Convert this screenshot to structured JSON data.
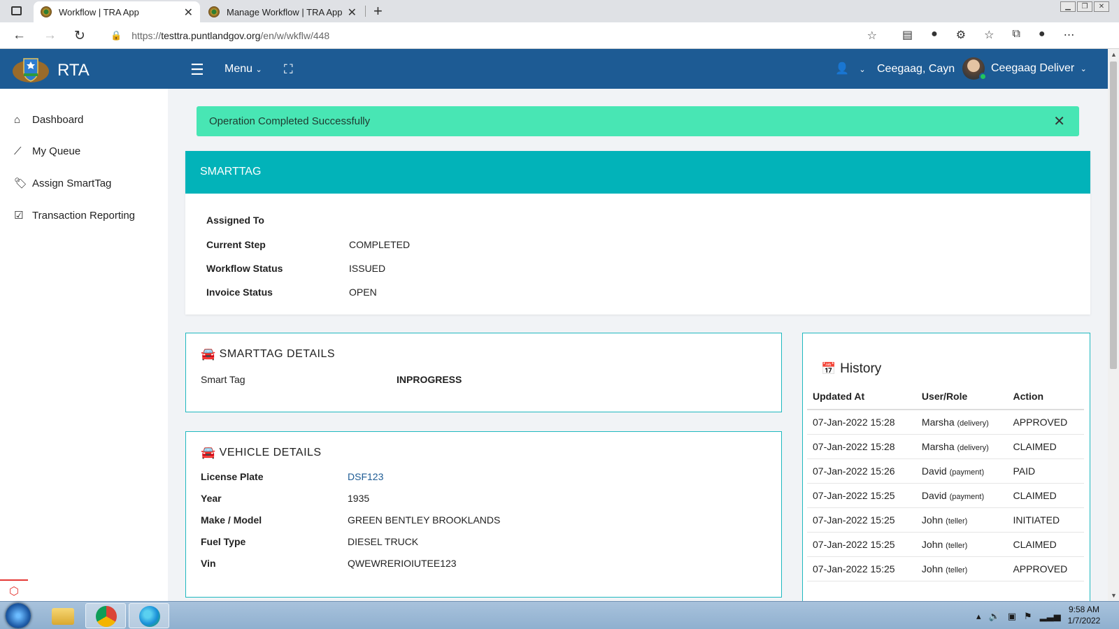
{
  "browser": {
    "tabs": [
      {
        "title": "Workflow | TRA App",
        "active": true
      },
      {
        "title": "Manage Workflow | TRA App",
        "active": false
      }
    ],
    "url_prefix": "https://",
    "url_host": "testtra.puntlandgov.org",
    "url_path": "/en/w/wkflw/448"
  },
  "header": {
    "brand": "RTA",
    "menu_label": "Menu",
    "location": "Ceegaag, Cayn",
    "user_name": "Ceegaag Deliver"
  },
  "sidebar": {
    "items": [
      {
        "label": "Dashboard",
        "icon": "home-icon"
      },
      {
        "label": "My Queue",
        "icon": "chart-line-icon"
      },
      {
        "label": "Assign SmartTag",
        "icon": "tags-icon"
      },
      {
        "label": "Transaction Reporting",
        "icon": "check-square-icon"
      }
    ]
  },
  "alert": {
    "message": "Operation Completed Successfully"
  },
  "smarttag": {
    "title": "SMARTTAG",
    "fields": [
      {
        "label": "Assigned To",
        "value": ""
      },
      {
        "label": "Current Step",
        "value": "COMPLETED"
      },
      {
        "label": "Workflow Status",
        "value": "ISSUED"
      },
      {
        "label": "Invoice Status",
        "value": "OPEN"
      }
    ]
  },
  "smarttag_details": {
    "title": "SMARTTAG DETAILS",
    "label": "Smart Tag",
    "value": "INPROGRESS"
  },
  "vehicle_details": {
    "title": "VEHICLE DETAILS",
    "fields": [
      {
        "label": "License Plate",
        "value": "DSF123"
      },
      {
        "label": "Year",
        "value": "1935"
      },
      {
        "label": "Make / Model",
        "value": "GREEN BENTLEY BROOKLANDS"
      },
      {
        "label": "Fuel Type",
        "value": "DIESEL TRUCK"
      },
      {
        "label": "Vin",
        "value": "QWEWRERIOIUTEE123"
      }
    ]
  },
  "history": {
    "title": "History",
    "columns": [
      "Updated At",
      "User/Role",
      "Action"
    ],
    "rows": [
      {
        "updated_at": "07-Jan-2022 15:28",
        "user": "Marsha",
        "role": "(delivery)",
        "action": "APPROVED"
      },
      {
        "updated_at": "07-Jan-2022 15:28",
        "user": "Marsha",
        "role": "(delivery)",
        "action": "CLAIMED"
      },
      {
        "updated_at": "07-Jan-2022 15:26",
        "user": "David",
        "role": "(payment)",
        "action": "PAID"
      },
      {
        "updated_at": "07-Jan-2022 15:25",
        "user": "David",
        "role": "(payment)",
        "action": "CLAIMED"
      },
      {
        "updated_at": "07-Jan-2022 15:25",
        "user": "John",
        "role": "(teller)",
        "action": "INITIATED"
      },
      {
        "updated_at": "07-Jan-2022 15:25",
        "user": "John",
        "role": "(teller)",
        "action": "CLAIMED"
      },
      {
        "updated_at": "07-Jan-2022 15:25",
        "user": "John",
        "role": "(teller)",
        "action": "APPROVED"
      }
    ]
  },
  "taskbar": {
    "time": "9:58 AM",
    "date": "1/7/2022"
  },
  "colors": {
    "header": "#1d5b94",
    "teal": "#02b3b9",
    "alert": "#48e6b4"
  }
}
